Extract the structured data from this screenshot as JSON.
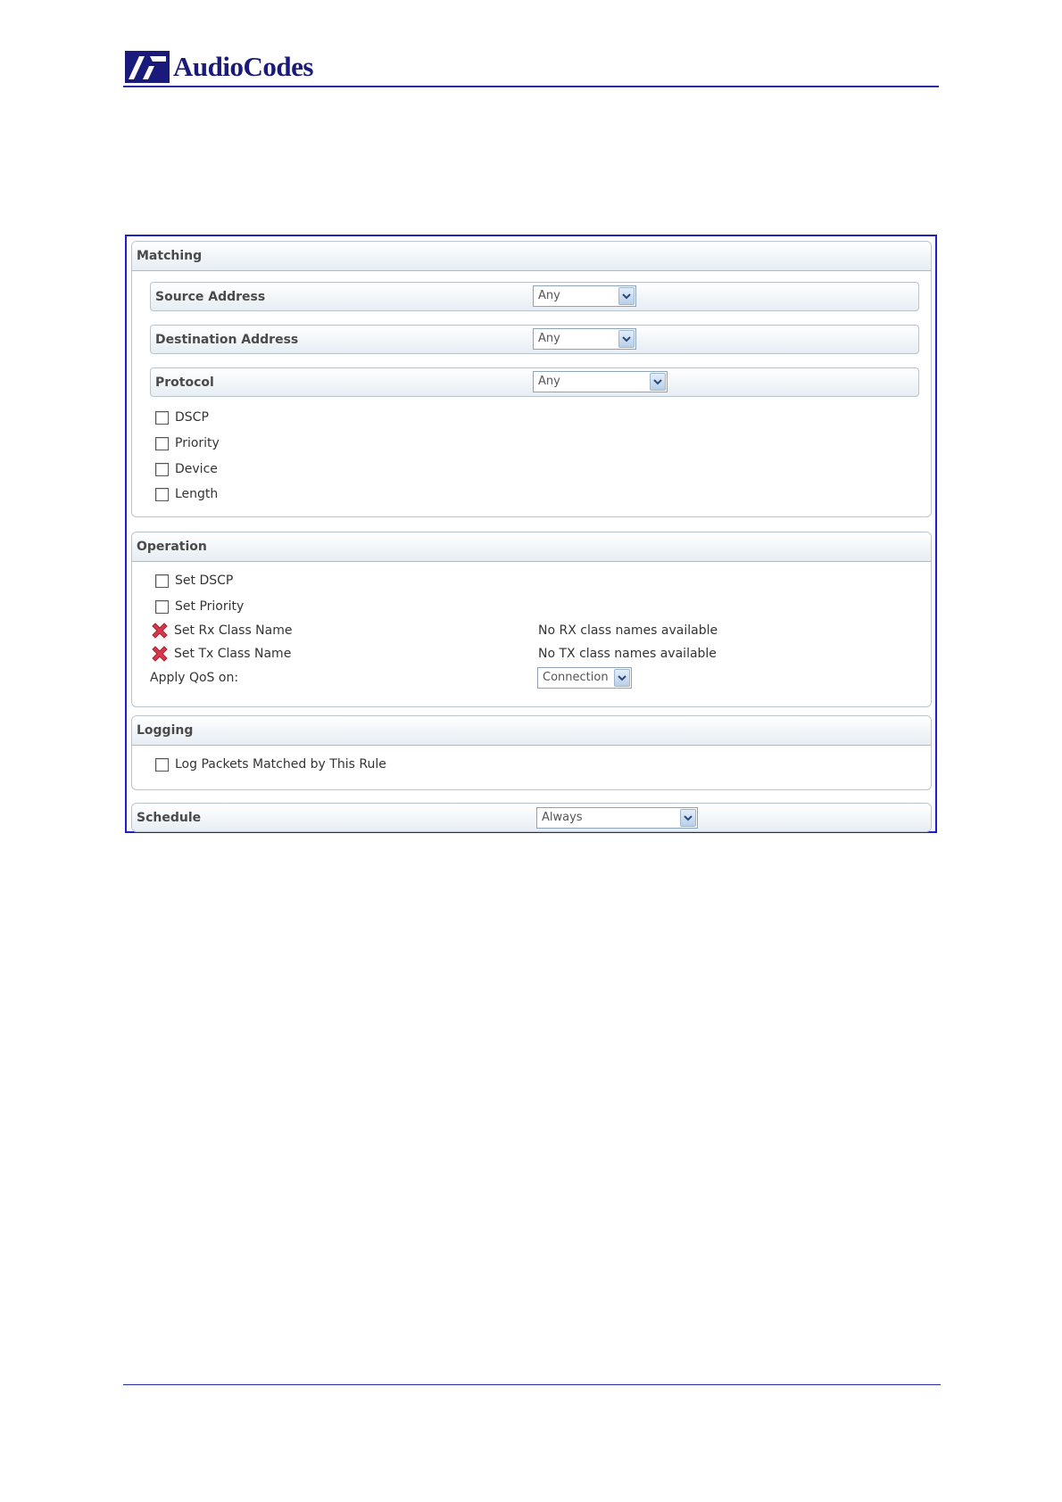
{
  "brand": {
    "name": "AudioCodes",
    "color": "#1a1a7a"
  },
  "frame_color": "#1f1fc4",
  "matching": {
    "title": "Matching",
    "source_address": {
      "label": "Source Address",
      "value": "Any"
    },
    "destination_address": {
      "label": "Destination Address",
      "value": "Any"
    },
    "protocol": {
      "label": "Protocol",
      "value": "Any"
    },
    "checkboxes": [
      "DSCP",
      "Priority",
      "Device",
      "Length"
    ]
  },
  "operation": {
    "title": "Operation",
    "set_dscp": "Set DSCP",
    "set_priority": "Set Priority",
    "set_rx_class_name": {
      "label": "Set Rx Class Name",
      "status": "No RX class names available",
      "icon": "red-x-icon"
    },
    "set_tx_class_name": {
      "label": "Set Tx Class Name",
      "status": "No TX class names available",
      "icon": "red-x-icon"
    },
    "apply_qos": {
      "label": "Apply QoS on:",
      "value": "Connection"
    }
  },
  "logging": {
    "title": "Logging",
    "log_packets": "Log Packets Matched by This Rule"
  },
  "schedule": {
    "title": "Schedule",
    "value": "Always"
  }
}
